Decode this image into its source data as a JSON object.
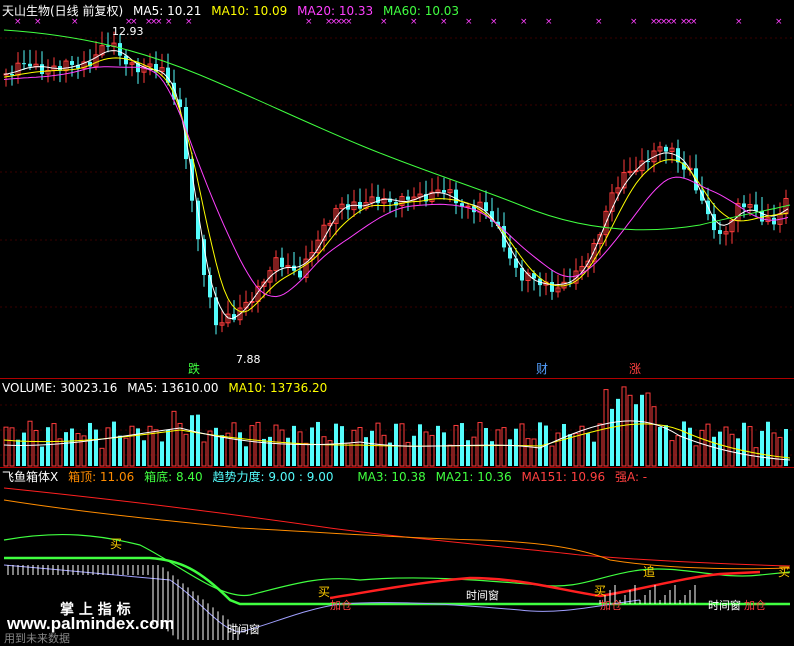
{
  "price_panel": {
    "title": "天山生物(日线 前复权)",
    "ma5": "MA5: 10.21",
    "ma10": "MA10: 10.09",
    "ma20": "MA20: 10.33",
    "ma60": "MA60: 10.03",
    "high_label": "12.93",
    "low_label": "7.88",
    "events": {
      "die": "跌",
      "cai": "财",
      "zhang": "涨"
    }
  },
  "volume_panel": {
    "volume": "VOLUME: 30023.16",
    "ma5": "MA5: 13610.00",
    "ma10": "MA10: 13736.20"
  },
  "indicator_panel": {
    "name": "飞鱼箱体X",
    "box_top": "箱顶: 11.06",
    "box_bottom": "箱底: 8.40",
    "trend": "趋势力度: 9.00 : 9.00",
    "ma3": "MA3: 10.38",
    "ma21": "MA21: 10.36",
    "ma151": "MA151: 10.96",
    "strong": "强A: -",
    "signals": {
      "buy1": "买",
      "buy2": "买",
      "buy3": "买",
      "buy4": "买",
      "chase": "追",
      "add1": "加仓",
      "add2": "加仓",
      "add3": "加仓",
      "window1": "时间窗",
      "window2": "时间窗",
      "window3": "时间窗"
    }
  },
  "watermark": {
    "brand": "掌 上 指 标",
    "site": "www.palmindex.com",
    "sub": "用到未来数据"
  },
  "colors": {
    "up": "#ff3c3c",
    "down": "#54fcfc",
    "ma5": "#ffffff",
    "ma10": "#ffff00",
    "ma20": "#ff40ff",
    "ma60": "#40ff40",
    "grid": "#b00000"
  }
}
